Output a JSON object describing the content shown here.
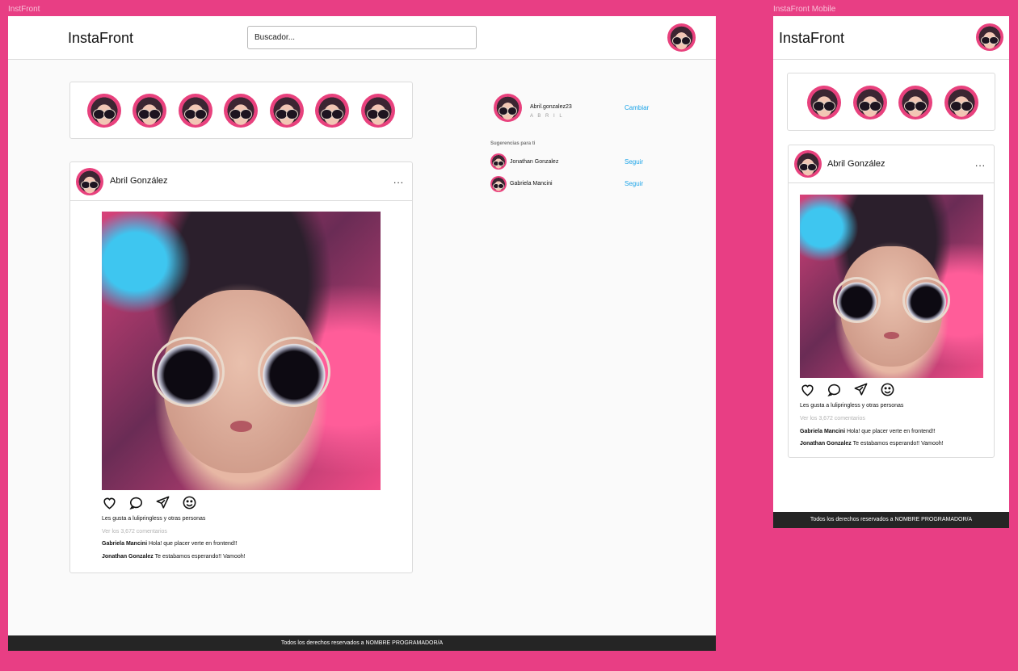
{
  "frames": {
    "desktop_label": "InstFront",
    "mobile_label": "InstaFront Mobile"
  },
  "app": {
    "title": "InstaFront"
  },
  "search": {
    "placeholder": "Buscador..."
  },
  "profile": {
    "username": "Abril.gonzalez23",
    "display": "A B R I L",
    "switch_label": "Cambiar"
  },
  "suggestions": {
    "title": "Sugerencias para ti",
    "items": [
      {
        "name": "Jonathan Gonzalez",
        "action": "Seguir"
      },
      {
        "name": "Gabriela Mancini",
        "action": "Seguir"
      }
    ]
  },
  "post": {
    "author": "Abril González",
    "menu": "...",
    "likes": "Les gusta a lulipringless y otras personas",
    "view_comments": "Ver los 3,672 comentarios",
    "comments": [
      {
        "user": "Gabriela Mancini",
        "text": "Hola! que placer verte en frontend!!"
      },
      {
        "user": "Jonathan Gonzalez",
        "text": "Te estabamos esperando!! Vamooh!"
      }
    ]
  },
  "stories": {
    "desktop_count": 7,
    "mobile_count": 4
  },
  "footer": {
    "text": "Todos los derechos reservados a NOMBRE PROGRAMADOR/A"
  },
  "colors": {
    "background": "#e83e84",
    "link": "#1aa3e8",
    "footer": "#252525"
  },
  "icons": [
    "heart-icon",
    "comment-icon",
    "send-icon",
    "emoji-icon",
    "more-icon",
    "avatar"
  ]
}
